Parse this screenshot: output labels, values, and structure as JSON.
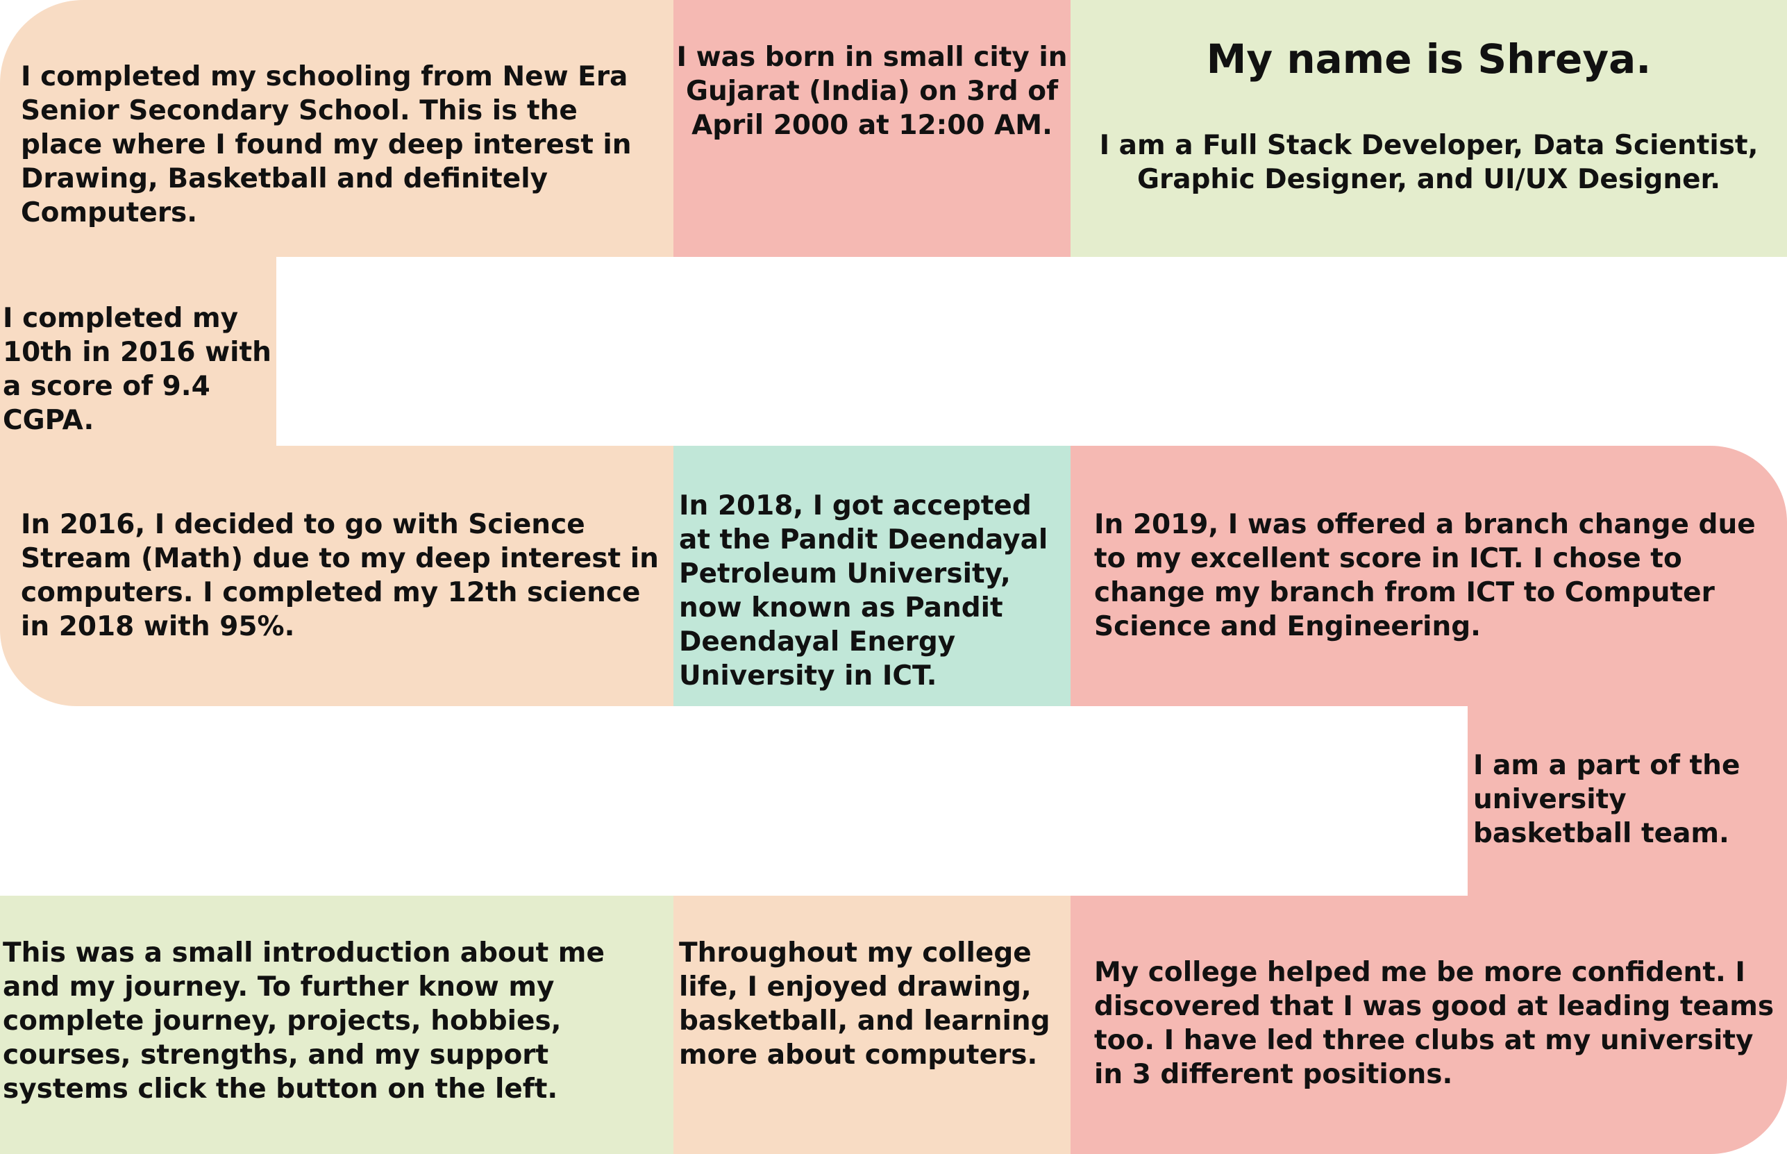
{
  "tiles": {
    "school": "I completed my schooling from New Era Senior Secondary School. This is the place where I found my deep interest in Drawing, Basketball and definitely Computers.",
    "born": "I was born in small city in Gujarat (India) on 3rd of April 2000 at 12:00 AM.",
    "name_title": "My name is Shreya.",
    "name_subtitle": "I am a Full Stack Developer, Data Scientist, Graphic Designer, and UI/UX Designer.",
    "tenth": "I completed my 10th in 2016 with a score of 9.4 CGPA.",
    "science": "In 2016, I decided to go with Science Stream (Math) due to my deep interest in computers. I completed my 12th science in 2018 with 95%.",
    "pdpu": "In 2018, I got accepted at the Pandit Deendayal Petroleum University, now known as Pandit Deendayal Energy University in ICT.",
    "branch": "In 2019, I was offered a branch change due to my excellent score in ICT. I chose to change my branch from ICT to Computer Science and Engineering.",
    "basketball": "I am a part of the university basketball team.",
    "intro": "This was a small introduction about me and my journey. To further know my complete journey, projects, hobbies, courses, strengths, and my support systems click the button on the left.",
    "college_life": "Throughout my college life, I enjoyed drawing, basketball, and learning more about computers.",
    "confident": "My college helped me be more confident. I discovered that I was good at leading teams too. I have led three clubs at my university in 3 different positions."
  },
  "colors": {
    "peach": "#f8dcc4",
    "pink": "#f5b9b3",
    "green": "#e4edcd",
    "mint": "#c1e7d8"
  }
}
